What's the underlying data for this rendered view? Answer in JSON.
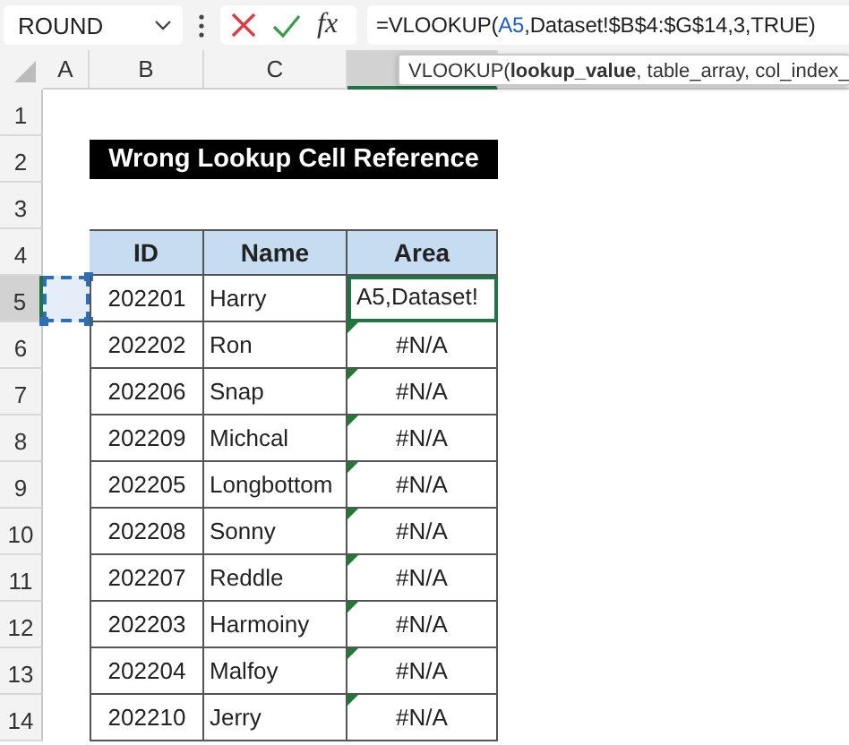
{
  "name_box": {
    "value": "ROUND"
  },
  "function_button": "fx",
  "formula": {
    "before": "=VLOOKUP(",
    "reference": "A5",
    "after": ",Dataset!$B$4:$G$14,3,TRUE)"
  },
  "tooltip": "VLOOKUP(**lookup_value**, table_array, col_index_",
  "columns": [
    {
      "label": "A",
      "selected": false
    },
    {
      "label": "B",
      "selected": false
    },
    {
      "label": "C",
      "selected": false
    },
    {
      "selected": true
    }
  ],
  "rows": [
    {
      "number": "1",
      "selected": false
    },
    {
      "number": "2",
      "selected": false
    },
    {
      "number": "3",
      "selected": false
    },
    {
      "number": "4",
      "selected": false
    },
    {
      "number": "5",
      "selected": true
    },
    {
      "number": "6",
      "selected": false
    },
    {
      "number": "7",
      "selected": false
    },
    {
      "number": "8",
      "selected": false
    },
    {
      "number": "9",
      "selected": false
    },
    {
      "number": "10",
      "selected": false
    },
    {
      "number": "11",
      "selected": false
    },
    {
      "number": "12",
      "selected": false
    },
    {
      "number": "13",
      "selected": false
    },
    {
      "number": "14",
      "selected": false
    }
  ],
  "title": "Wrong Lookup Cell Reference",
  "table": {
    "columns": [
      "ID",
      "Name",
      "Area"
    ],
    "rows": [
      {
        "id": "202201",
        "name": "Harry",
        "area": "A5,Dataset!",
        "editing": true,
        "error": false
      },
      {
        "id": "202202",
        "name": "Ron",
        "area": "#N/A",
        "editing": false,
        "error": true
      },
      {
        "id": "202206",
        "name": "Snap",
        "area": "#N/A",
        "editing": false,
        "error": true
      },
      {
        "id": "202209",
        "name": "Michcal",
        "area": "#N/A",
        "editing": false,
        "error": true
      },
      {
        "id": "202205",
        "name": "Longbottom",
        "area": "#N/A",
        "editing": false,
        "error": true
      },
      {
        "id": "202208",
        "name": "Sonny",
        "area": "#N/A",
        "editing": false,
        "error": true
      },
      {
        "id": "202207",
        "name": "Reddle",
        "area": "#N/A",
        "editing": false,
        "error": true
      },
      {
        "id": "202203",
        "name": "Harmoiny",
        "area": "#N/A",
        "editing": false,
        "error": true
      },
      {
        "id": "202204",
        "name": "Malfoy",
        "area": "#N/A",
        "editing": false,
        "error": true
      },
      {
        "id": "202210",
        "name": "Jerry",
        "area": "#N/A",
        "editing": false,
        "error": true
      }
    ]
  }
}
